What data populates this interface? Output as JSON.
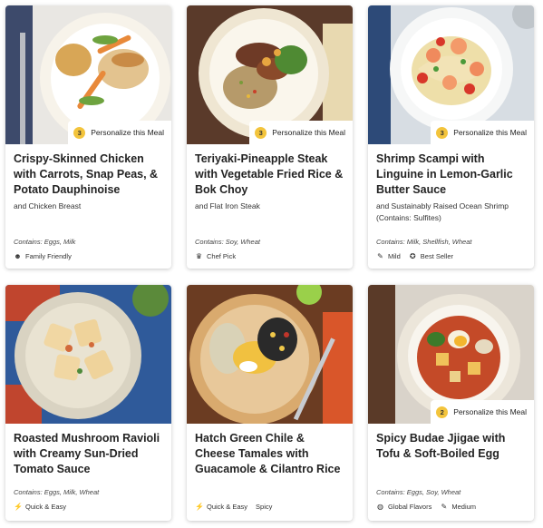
{
  "personalize_label": "Personalize this Meal",
  "meals": [
    {
      "title": "Crispy-Skinned Chicken with Carrots, Snap Peas, & Potato Dauphinoise",
      "subtitle": "and Chicken Breast",
      "options_count": "3",
      "contains": "Contains: Eggs, Milk",
      "tags": [
        {
          "icon": "smiley-icon",
          "glyph": "☻",
          "label": "Family Friendly"
        }
      ]
    },
    {
      "title": "Teriyaki-Pineapple Steak with Vegetable Fried Rice & Bok Choy",
      "subtitle": "and Flat Iron Steak",
      "options_count": "3",
      "contains": "Contains: Soy, Wheat",
      "tags": [
        {
          "icon": "chef-hat-icon",
          "glyph": "♛",
          "label": "Chef Pick"
        }
      ]
    },
    {
      "title": "Shrimp Scampi with Linguine in Lemon-Garlic Butter Sauce",
      "subtitle": "and Sustainably Raised Ocean Shrimp (Contains: Sulfites)",
      "options_count": "3",
      "contains": "Contains: Milk, Shellfish, Wheat",
      "tags": [
        {
          "icon": "pepper-icon",
          "glyph": "✎",
          "label": "Mild"
        },
        {
          "icon": "ribbon-icon",
          "glyph": "✪",
          "label": "Best Seller"
        }
      ]
    },
    {
      "title": "Roasted Mushroom Ravioli with Creamy Sun-Dried Tomato Sauce",
      "subtitle": "",
      "options_count": "",
      "contains": "Contains: Eggs, Milk, Wheat",
      "tags": [
        {
          "icon": "lightning-icon",
          "glyph": "⚡",
          "label": "Quick & Easy"
        }
      ]
    },
    {
      "title": "Hatch Green Chile & Cheese Tamales with Guacamole & Cilantro Rice",
      "subtitle": "",
      "options_count": "",
      "contains": "",
      "tags": [
        {
          "icon": "lightning-icon",
          "glyph": "⚡",
          "label": "Quick & Easy"
        },
        {
          "icon": "",
          "glyph": "",
          "label": "Spicy"
        }
      ]
    },
    {
      "title": "Spicy Budae Jjigae with Tofu & Soft-Boiled Egg",
      "subtitle": "",
      "options_count": "2",
      "contains": "Contains: Eggs, Soy, Wheat",
      "tags": [
        {
          "icon": "globe-icon",
          "glyph": "◍",
          "label": "Global Flavors"
        },
        {
          "icon": "pepper-icon",
          "glyph": "✎",
          "label": "Medium"
        }
      ]
    }
  ]
}
